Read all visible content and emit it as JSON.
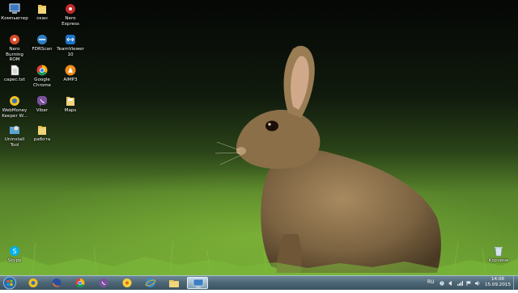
{
  "desktop": {
    "icons": [
      {
        "label": "Компьютер",
        "icon": "computer-icon"
      },
      {
        "label": "скан",
        "icon": "folder-icon"
      },
      {
        "label": "Nero Express",
        "icon": "nero-express-icon"
      },
      {
        "label": "Nero Burning ROM",
        "icon": "nero-burning-rom-icon"
      },
      {
        "label": "FDRScan",
        "icon": "fdrscan-icon"
      },
      {
        "label": "TeamViewer 10",
        "icon": "teamviewer-icon"
      },
      {
        "label": "сарес.txt",
        "icon": "text-file-icon"
      },
      {
        "label": "Google Chrome",
        "icon": "chrome-icon"
      },
      {
        "label": "AIMP3",
        "icon": "aimp-icon"
      },
      {
        "label": "WebMoney Keeper W...",
        "icon": "webmoney-icon"
      },
      {
        "label": "Viber",
        "icon": "viber-icon"
      },
      {
        "label": "Maps",
        "icon": "folder-maps-icon"
      },
      {
        "label": "Uninstall Tool",
        "icon": "uninstall-tool-icon"
      },
      {
        "label": "работа",
        "icon": "folder-icon"
      },
      {
        "label": "Skype",
        "icon": "skype-icon"
      },
      {
        "label": "Корзина",
        "icon": "recycle-bin-icon"
      }
    ]
  },
  "taskbar": {
    "pinned": [
      "webmoney-icon",
      "firefox-icon",
      "chrome-icon",
      "viber-icon",
      "icq-icon",
      "internet-explorer-icon",
      "explorer-folder-icon",
      "remote-desktop-icon"
    ],
    "language": "RU",
    "time": "14:06",
    "date": "15.09.2015"
  },
  "colors": {
    "taskbar": "#4f6877",
    "accent": "#d9e7ef"
  }
}
